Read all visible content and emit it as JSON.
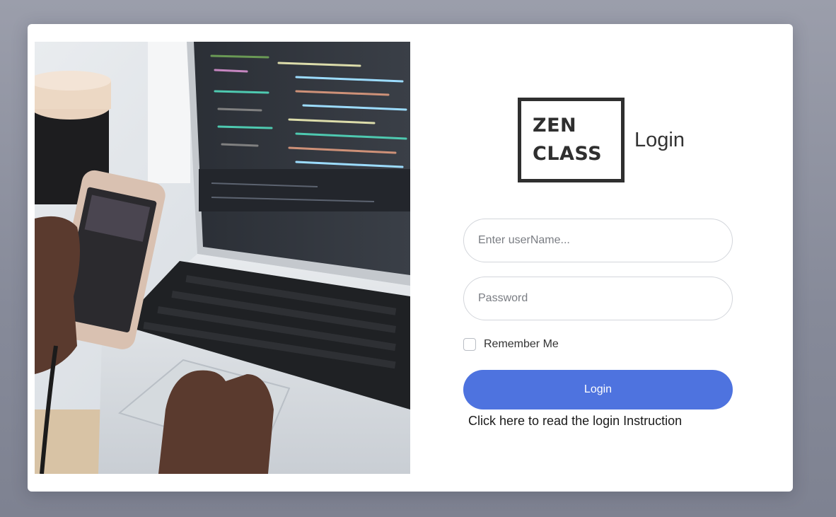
{
  "logo": {
    "line1": "ZEN",
    "line2": "CLASS"
  },
  "heading": "Login",
  "form": {
    "username_placeholder": "Enter userName...",
    "password_placeholder": "Password",
    "remember_label": "Remember Me",
    "remember_checked": false,
    "login_button": "Login",
    "instruction_link": "Click here to read the login Instruction"
  },
  "colors": {
    "accent": "#4e73df",
    "background": "#8a8e9c",
    "card": "#ffffff",
    "logo_border": "#2f2f2f"
  },
  "image": {
    "subject": "laptop-with-code-and-smartphone"
  }
}
